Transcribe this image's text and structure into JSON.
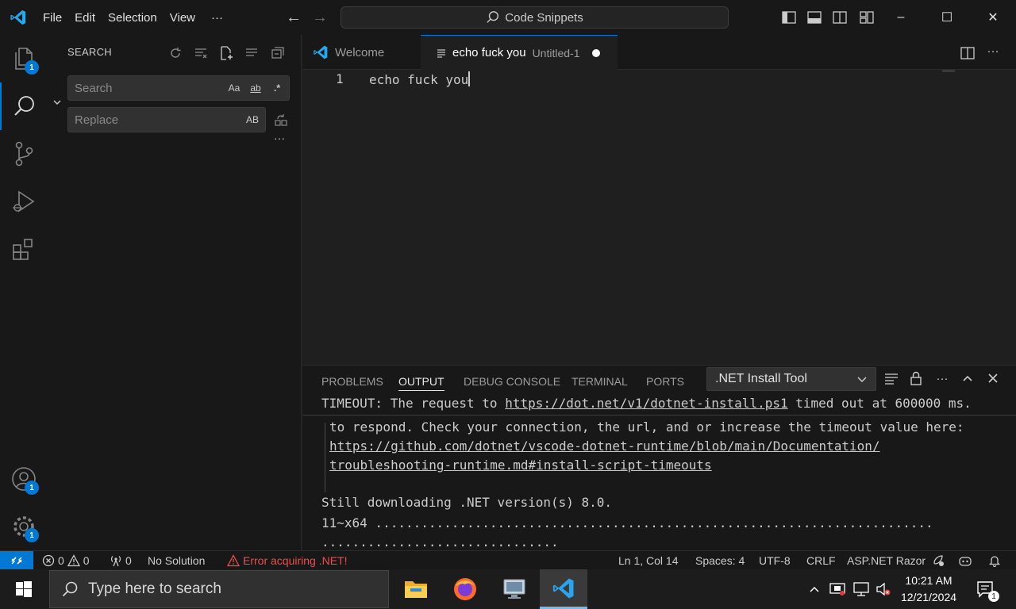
{
  "titlebar": {
    "menu": [
      "File",
      "Edit",
      "Selection",
      "View"
    ],
    "more": "···",
    "command_center": "Code Snippets",
    "window": {
      "minimize": "–",
      "maximize": "☐",
      "close": "✕"
    }
  },
  "activity_bar": {
    "items": [
      {
        "name": "explorer",
        "badge": "1"
      },
      {
        "name": "search",
        "active": true
      },
      {
        "name": "source-control"
      },
      {
        "name": "run-and-debug"
      },
      {
        "name": "extensions"
      }
    ],
    "accounts_badge": "1",
    "manage_badge": "1"
  },
  "sidebar": {
    "title": "SEARCH",
    "search": {
      "placeholder": "Search",
      "value": "",
      "options": [
        "Aa",
        "ab",
        ".*"
      ]
    },
    "replace": {
      "placeholder": "Replace",
      "value": "",
      "options": [
        "AB"
      ]
    },
    "more": "···"
  },
  "editor": {
    "tabs": [
      {
        "label": "Welcome",
        "active": false
      },
      {
        "label": "echo fuck you",
        "description": "Untitled-1",
        "active": true,
        "dirty": true
      }
    ],
    "lines": [
      {
        "number": "1",
        "text": "echo fuck you"
      }
    ]
  },
  "panel": {
    "tabs": [
      "PROBLEMS",
      "OUTPUT",
      "DEBUG CONSOLE",
      "TERMINAL",
      "PORTS"
    ],
    "active_tab": "OUTPUT",
    "output_channel": ".NET Install Tool",
    "output": {
      "sticky": {
        "prefix": "TIMEOUT: The request to ",
        "link": "https://dot.net/v1/dotnet-install.ps1",
        "suffix": " timed out at 600000 ms."
      },
      "line2": "to respond. Check your connection, the url, and or increase the timeout value here:",
      "link_a": "https://github.com/dotnet/vscode-dotnet-runtime/blob/main/Documentation/",
      "link_b": "troubleshooting-runtime.md#install-script-timeouts",
      "line5": "Still downloading .NET version(s) 8.0.",
      "line6": "11~x64 .........................................................................",
      "line7": "..............................."
    }
  },
  "statusbar": {
    "errors": "0",
    "warnings": "0",
    "ports": "0",
    "solution": "No Solution",
    "error_text": "Error acquiring .NET!",
    "cursor": "Ln 1, Col 14",
    "spaces": "Spaces: 4",
    "encoding": "UTF-8",
    "eol": "CRLF",
    "language": "ASP.NET Razor"
  },
  "taskbar": {
    "search_placeholder": "Type here to search",
    "apps": [
      "file-explorer",
      "firefox",
      "remote-desktop",
      "vscode"
    ],
    "time": "10:21 AM",
    "date": "12/21/2024",
    "notification_count": "1"
  },
  "colors": {
    "accent": "#0078d4",
    "background": "#1f1f1f",
    "chrome": "#181818",
    "error": "#f14c4c"
  }
}
